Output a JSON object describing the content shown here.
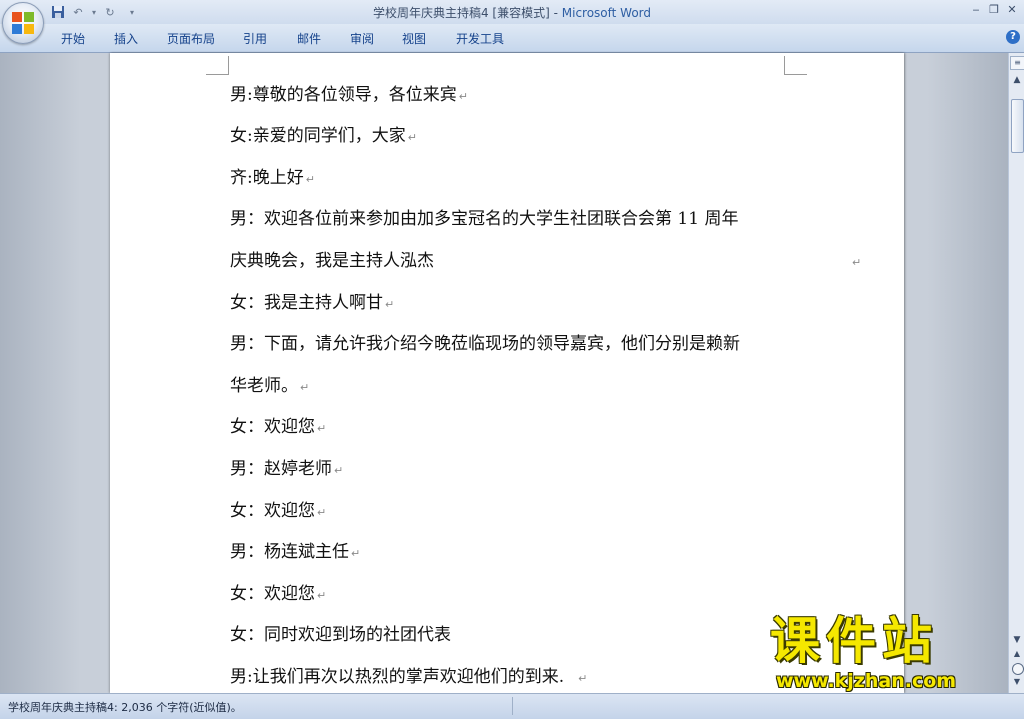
{
  "titlebar": {
    "doc_title": "学校周年庆典主持稿4 [兼容模式] - ",
    "app_name": "Microsoft Word"
  },
  "ribbon": {
    "tabs": [
      "开始",
      "插入",
      "页面布局",
      "引用",
      "邮件",
      "审阅",
      "视图",
      "开发工具"
    ]
  },
  "document": {
    "lines": [
      "男:尊敬的各位领导，各位来宾",
      "女:亲爱的同学们，大家",
      "齐:晚上好",
      "男：欢迎各位前来参加由加多宝冠名的大学生社团联合会第 11 周年",
      "庆典晚会，我是主持人泓杰",
      "女：我是主持人啊甘",
      "男：下面，请允许我介绍今晚莅临现场的领导嘉宾，他们分别是赖新",
      "华老师。",
      "女：欢迎您",
      "男：赵婷老师",
      "女：欢迎您",
      "男：杨连斌主任",
      "女：欢迎您",
      "女：同时欢迎到场的社团代表",
      "男:让我们再次以热烈的掌声欢迎他们的到来."
    ],
    "paragraph_mark": "↵"
  },
  "statusbar": {
    "text": "学校周年庆典主持稿4: 2,036 个字符(近似值)。"
  },
  "watermark": {
    "cn": "课件站",
    "url": "www.kjzhan.com"
  }
}
